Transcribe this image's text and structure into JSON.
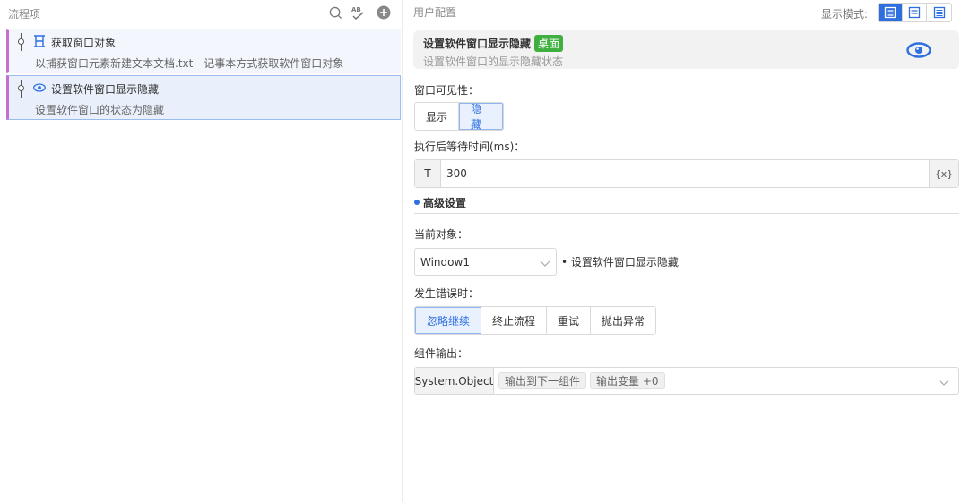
{
  "left": {
    "title": "流程项",
    "items": [
      {
        "title": "获取窗口对象",
        "desc": "以捕获窗口元素新建文本文档.txt - 记事本方式获取软件窗口对象"
      },
      {
        "title": "设置软件窗口显示隐藏",
        "desc": "设置软件窗口的状态为隐藏"
      }
    ]
  },
  "right": {
    "title": "用户配置",
    "mode_label": "显示模式:",
    "info": {
      "title": "设置软件窗口显示隐藏",
      "badge": "桌面",
      "desc": "设置软件窗口的显示隐藏状态"
    },
    "visibility": {
      "label": "窗口可见性：",
      "options": [
        "显示",
        "隐藏"
      ],
      "selected": "隐藏"
    },
    "wait": {
      "label": "执行后等待时间(ms)：",
      "prefix": "T",
      "value": "300",
      "suffix": "{x}"
    },
    "advanced": {
      "title": "高级设置",
      "target_label": "当前对象：",
      "target_value": "Window1",
      "target_note": "设置软件窗口显示隐藏",
      "error_label": "发生错误时：",
      "error_options": [
        "忽略继续",
        "终止流程",
        "重试",
        "抛出异常"
      ],
      "error_selected": "忽略继续",
      "output_label": "组件输出：",
      "output_type": "System.Object",
      "output_tag1": "输出到下一组件",
      "output_tag2": "输出变量 +0"
    }
  },
  "colors": {
    "accent": "#2e6fe0",
    "badge": "#3fb040",
    "flow_marker": "#c56fd2"
  }
}
